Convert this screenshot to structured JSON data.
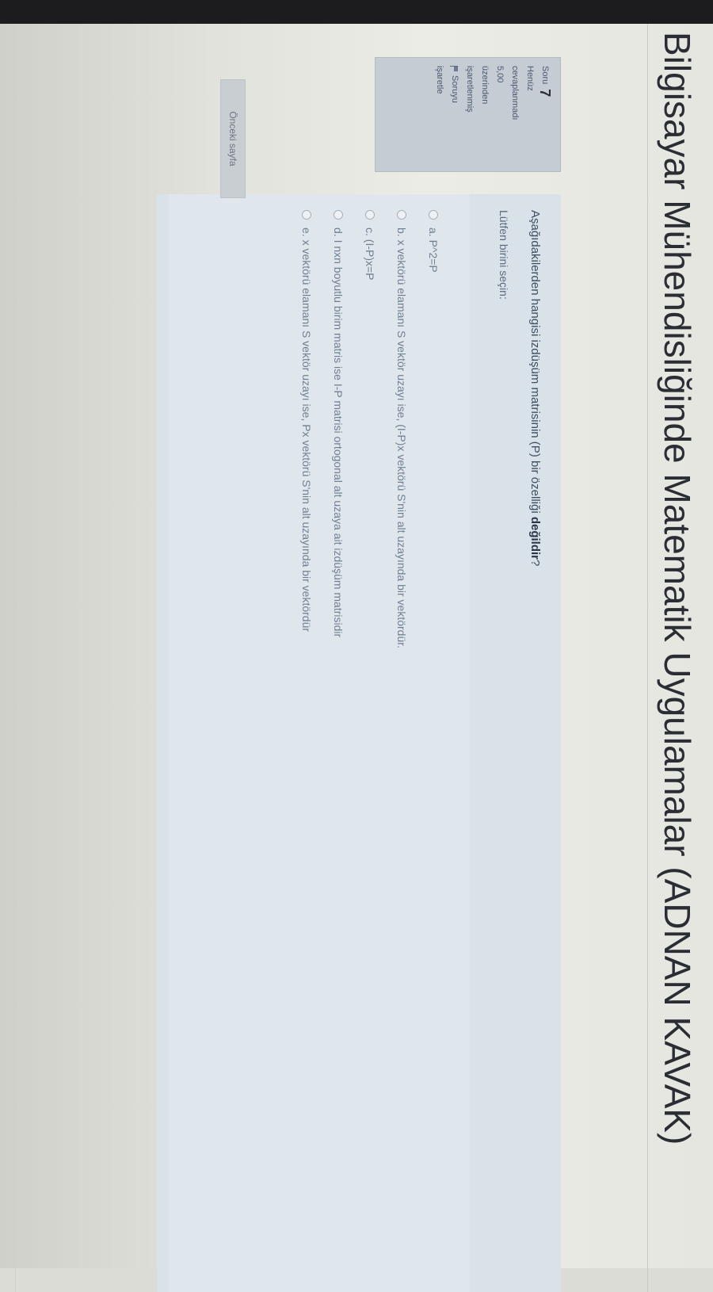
{
  "page_title": "Bilgisayar Mühendisliğinde Matematik Uygulamalar (ADNAN KAVAK)",
  "question_info": {
    "label": "Soru",
    "number": "7",
    "status_line1": "Henüz",
    "status_line2": "cevaplanmadı",
    "mark_line1": "5,00",
    "mark_line2": "üzerinden",
    "mark_line3": "işaretlenmiş",
    "flag_line1": "Soruyu",
    "flag_line2": "işaretle"
  },
  "question": {
    "text_before": "Aşağıdakilerden hangisi izdüşüm matrisinin (P) bir özelliği ",
    "text_bold": "değildir",
    "text_after": "?",
    "prompt": "Lütfen birini seçin:",
    "options": [
      "a. P^2=P",
      "b. x vektörü elamanı S vektör uzayı ise, (I-P)x vektörü S'nin alt uzayında bir vektördür.",
      "c. (I-P)x=P",
      "d. I nxn boyutlu birim matris ise I-P matrisi ortogonal alt uzaya ait izdüşüm matrisidir",
      "e. x vektörü elamanı S vektör uzayı ise, Px vektörü S'nin alt uzayında bir vektördür"
    ]
  },
  "nav": {
    "prev_label": "Önceki sayfa"
  },
  "colors": {
    "info_box": "#c6ccd3",
    "question_box": "#d9e2e9",
    "answers_box": "#e0e7ec",
    "title_text": "#2a2d33"
  }
}
